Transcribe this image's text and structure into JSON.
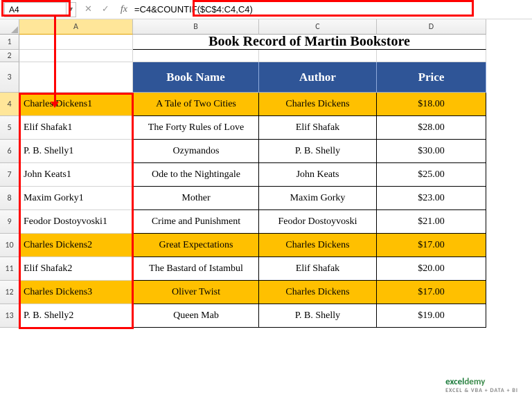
{
  "namebox": "A4",
  "formula": "=C4&COUNTIF($C$4:C4,C4)",
  "fx_label": "fx",
  "columns": [
    "A",
    "B",
    "C",
    "D"
  ],
  "col_widths": {
    "A": 164,
    "B": 182,
    "C": 170,
    "D": 158
  },
  "row_numbers": [
    "1",
    "2",
    "3",
    "4",
    "5",
    "6",
    "7",
    "8",
    "9",
    "10",
    "11",
    "12",
    "13"
  ],
  "selected_cell": {
    "row": 4,
    "col": "A"
  },
  "title": "Book Record of Martin Bookstore",
  "headers": {
    "b": "Book Name",
    "c": "Author",
    "d": "Price"
  },
  "table": [
    {
      "a": "Charles Dickens1",
      "b": "A Tale of Two Cities",
      "c": "Charles Dickens",
      "d": "$18.00",
      "hl": true
    },
    {
      "a": "Elif Shafak1",
      "b": "The Forty Rules of Love",
      "c": "Elif Shafak",
      "d": "$28.00",
      "hl": false
    },
    {
      "a": "P. B. Shelly1",
      "b": "Ozymandos",
      "c": "P. B. Shelly",
      "d": "$30.00",
      "hl": false
    },
    {
      "a": "John Keats1",
      "b": "Ode to the Nightingale",
      "c": "John Keats",
      "d": "$25.00",
      "hl": false
    },
    {
      "a": "Maxim Gorky1",
      "b": "Mother",
      "c": "Maxim Gorky",
      "d": "$23.00",
      "hl": false
    },
    {
      "a": "Feodor Dostoyvoski1",
      "b": "Crime and Punishment",
      "c": "Feodor Dostoyvoski",
      "d": "$21.00",
      "hl": false
    },
    {
      "a": "Charles Dickens2",
      "b": "Great Expectations",
      "c": "Charles Dickens",
      "d": "$17.00",
      "hl": true
    },
    {
      "a": "Elif Shafak2",
      "b": "The Bastard of Istambul",
      "c": "Elif Shafak",
      "d": "$20.00",
      "hl": false
    },
    {
      "a": "Charles Dickens3",
      "b": "Oliver Twist",
      "c": "Charles Dickens",
      "d": "$17.00",
      "hl": true
    },
    {
      "a": "P. B. Shelly2",
      "b": "Queen Mab",
      "c": "P. B. Shelly",
      "d": "$19.00",
      "hl": false
    }
  ],
  "watermark": {
    "brand_prefix": "excel",
    "brand_suffix": "demy",
    "tagline": "EXCEL & VBA + DATA + BI"
  }
}
